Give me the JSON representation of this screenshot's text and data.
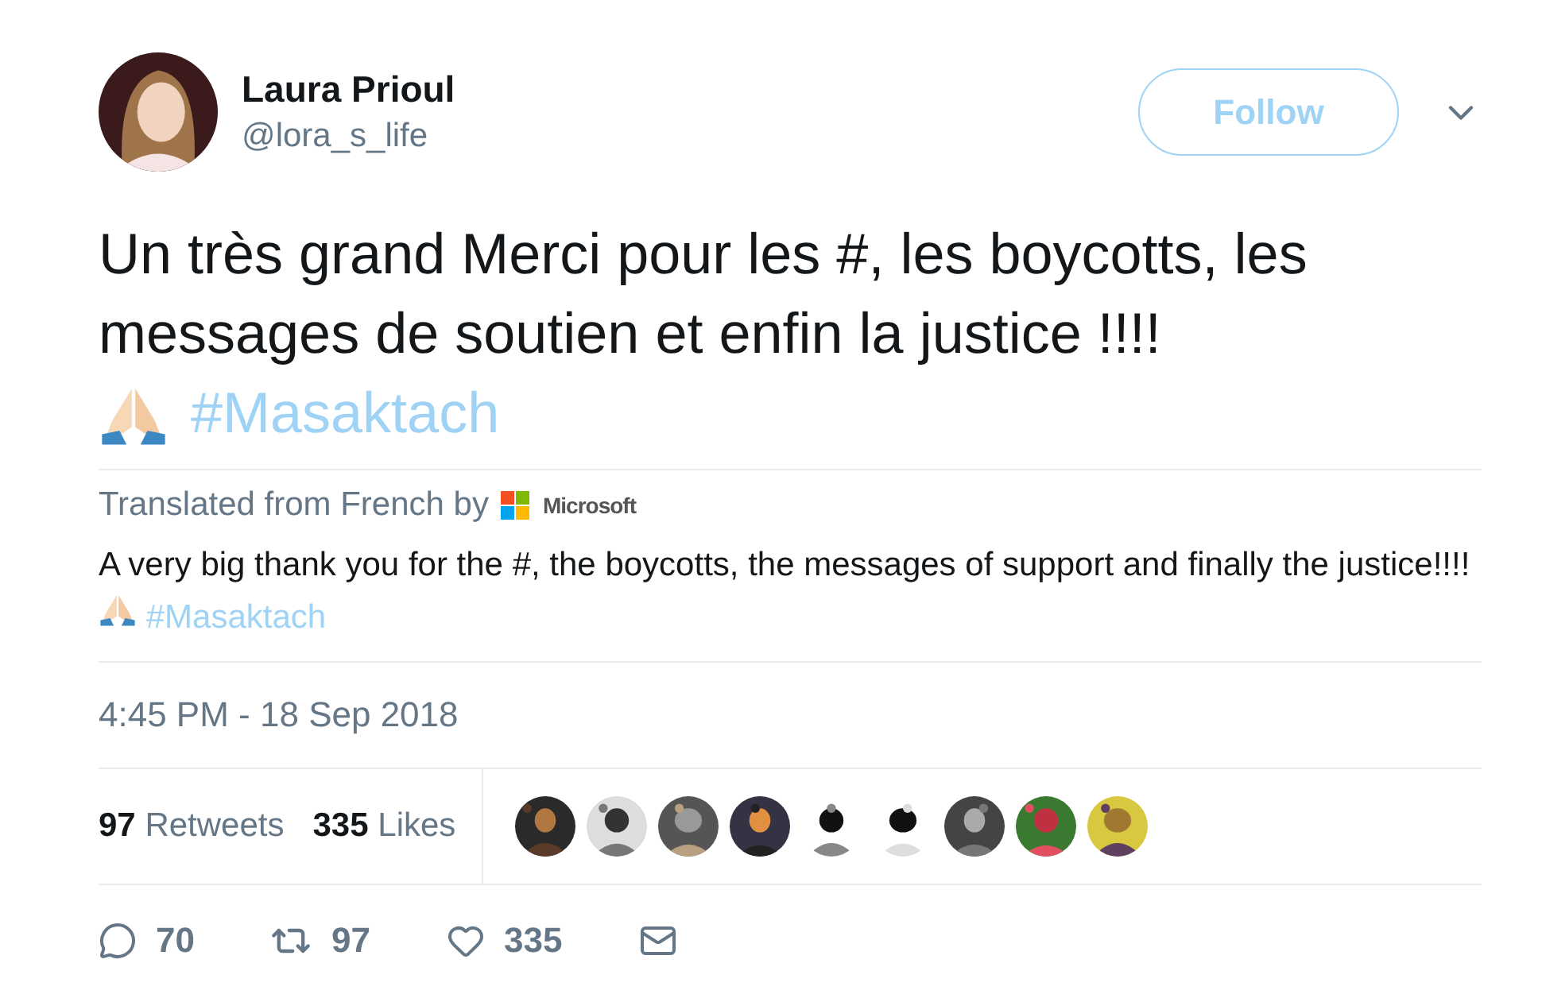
{
  "author": {
    "name": "Laura Prioul",
    "handle": "@lora_s_life"
  },
  "follow_button": "Follow",
  "tweet": {
    "text": "Un très grand Merci pour les #, les boycotts, les messages de soutien et enfin la justice !!!!",
    "hashtag": "#Masaktach"
  },
  "translation": {
    "label": "Translated from French by",
    "provider": "Microsoft",
    "text": "A very big thank you for the #, the boycotts, the messages of support and finally the justice!!!!",
    "hashtag": "#Masaktach"
  },
  "timestamp": "4:45 PM - 18 Sep 2018",
  "stats": [
    {
      "count": "97",
      "label": "Retweets"
    },
    {
      "count": "335",
      "label": "Likes"
    }
  ],
  "actions": [
    {
      "kind": "reply",
      "count": "70"
    },
    {
      "kind": "retweet",
      "count": "97"
    },
    {
      "kind": "like",
      "count": "335"
    },
    {
      "kind": "message"
    }
  ]
}
